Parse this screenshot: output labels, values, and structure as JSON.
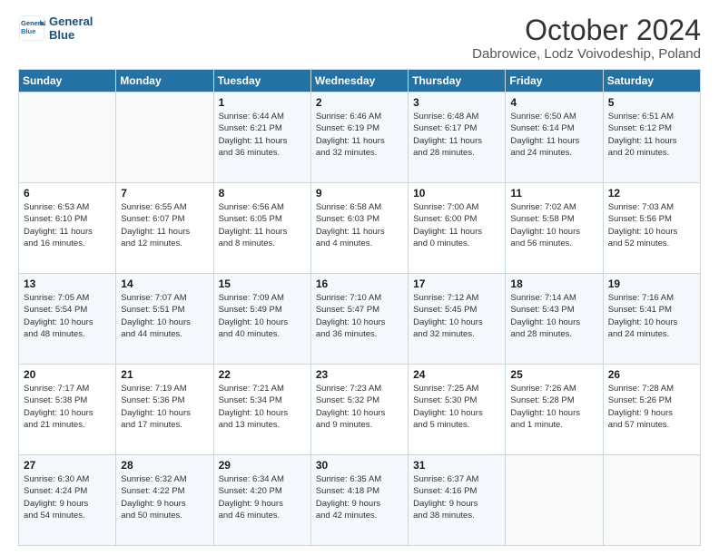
{
  "header": {
    "logo_line1": "General",
    "logo_line2": "Blue",
    "main_title": "October 2024",
    "subtitle": "Dabrowice, Lodz Voivodeship, Poland"
  },
  "weekdays": [
    "Sunday",
    "Monday",
    "Tuesday",
    "Wednesday",
    "Thursday",
    "Friday",
    "Saturday"
  ],
  "weeks": [
    [
      {
        "day": "",
        "info": ""
      },
      {
        "day": "",
        "info": ""
      },
      {
        "day": "1",
        "info": "Sunrise: 6:44 AM\nSunset: 6:21 PM\nDaylight: 11 hours\nand 36 minutes."
      },
      {
        "day": "2",
        "info": "Sunrise: 6:46 AM\nSunset: 6:19 PM\nDaylight: 11 hours\nand 32 minutes."
      },
      {
        "day": "3",
        "info": "Sunrise: 6:48 AM\nSunset: 6:17 PM\nDaylight: 11 hours\nand 28 minutes."
      },
      {
        "day": "4",
        "info": "Sunrise: 6:50 AM\nSunset: 6:14 PM\nDaylight: 11 hours\nand 24 minutes."
      },
      {
        "day": "5",
        "info": "Sunrise: 6:51 AM\nSunset: 6:12 PM\nDaylight: 11 hours\nand 20 minutes."
      }
    ],
    [
      {
        "day": "6",
        "info": "Sunrise: 6:53 AM\nSunset: 6:10 PM\nDaylight: 11 hours\nand 16 minutes."
      },
      {
        "day": "7",
        "info": "Sunrise: 6:55 AM\nSunset: 6:07 PM\nDaylight: 11 hours\nand 12 minutes."
      },
      {
        "day": "8",
        "info": "Sunrise: 6:56 AM\nSunset: 6:05 PM\nDaylight: 11 hours\nand 8 minutes."
      },
      {
        "day": "9",
        "info": "Sunrise: 6:58 AM\nSunset: 6:03 PM\nDaylight: 11 hours\nand 4 minutes."
      },
      {
        "day": "10",
        "info": "Sunrise: 7:00 AM\nSunset: 6:00 PM\nDaylight: 11 hours\nand 0 minutes."
      },
      {
        "day": "11",
        "info": "Sunrise: 7:02 AM\nSunset: 5:58 PM\nDaylight: 10 hours\nand 56 minutes."
      },
      {
        "day": "12",
        "info": "Sunrise: 7:03 AM\nSunset: 5:56 PM\nDaylight: 10 hours\nand 52 minutes."
      }
    ],
    [
      {
        "day": "13",
        "info": "Sunrise: 7:05 AM\nSunset: 5:54 PM\nDaylight: 10 hours\nand 48 minutes."
      },
      {
        "day": "14",
        "info": "Sunrise: 7:07 AM\nSunset: 5:51 PM\nDaylight: 10 hours\nand 44 minutes."
      },
      {
        "day": "15",
        "info": "Sunrise: 7:09 AM\nSunset: 5:49 PM\nDaylight: 10 hours\nand 40 minutes."
      },
      {
        "day": "16",
        "info": "Sunrise: 7:10 AM\nSunset: 5:47 PM\nDaylight: 10 hours\nand 36 minutes."
      },
      {
        "day": "17",
        "info": "Sunrise: 7:12 AM\nSunset: 5:45 PM\nDaylight: 10 hours\nand 32 minutes."
      },
      {
        "day": "18",
        "info": "Sunrise: 7:14 AM\nSunset: 5:43 PM\nDaylight: 10 hours\nand 28 minutes."
      },
      {
        "day": "19",
        "info": "Sunrise: 7:16 AM\nSunset: 5:41 PM\nDaylight: 10 hours\nand 24 minutes."
      }
    ],
    [
      {
        "day": "20",
        "info": "Sunrise: 7:17 AM\nSunset: 5:38 PM\nDaylight: 10 hours\nand 21 minutes."
      },
      {
        "day": "21",
        "info": "Sunrise: 7:19 AM\nSunset: 5:36 PM\nDaylight: 10 hours\nand 17 minutes."
      },
      {
        "day": "22",
        "info": "Sunrise: 7:21 AM\nSunset: 5:34 PM\nDaylight: 10 hours\nand 13 minutes."
      },
      {
        "day": "23",
        "info": "Sunrise: 7:23 AM\nSunset: 5:32 PM\nDaylight: 10 hours\nand 9 minutes."
      },
      {
        "day": "24",
        "info": "Sunrise: 7:25 AM\nSunset: 5:30 PM\nDaylight: 10 hours\nand 5 minutes."
      },
      {
        "day": "25",
        "info": "Sunrise: 7:26 AM\nSunset: 5:28 PM\nDaylight: 10 hours\nand 1 minute."
      },
      {
        "day": "26",
        "info": "Sunrise: 7:28 AM\nSunset: 5:26 PM\nDaylight: 9 hours\nand 57 minutes."
      }
    ],
    [
      {
        "day": "27",
        "info": "Sunrise: 6:30 AM\nSunset: 4:24 PM\nDaylight: 9 hours\nand 54 minutes."
      },
      {
        "day": "28",
        "info": "Sunrise: 6:32 AM\nSunset: 4:22 PM\nDaylight: 9 hours\nand 50 minutes."
      },
      {
        "day": "29",
        "info": "Sunrise: 6:34 AM\nSunset: 4:20 PM\nDaylight: 9 hours\nand 46 minutes."
      },
      {
        "day": "30",
        "info": "Sunrise: 6:35 AM\nSunset: 4:18 PM\nDaylight: 9 hours\nand 42 minutes."
      },
      {
        "day": "31",
        "info": "Sunrise: 6:37 AM\nSunset: 4:16 PM\nDaylight: 9 hours\nand 38 minutes."
      },
      {
        "day": "",
        "info": ""
      },
      {
        "day": "",
        "info": ""
      }
    ]
  ]
}
